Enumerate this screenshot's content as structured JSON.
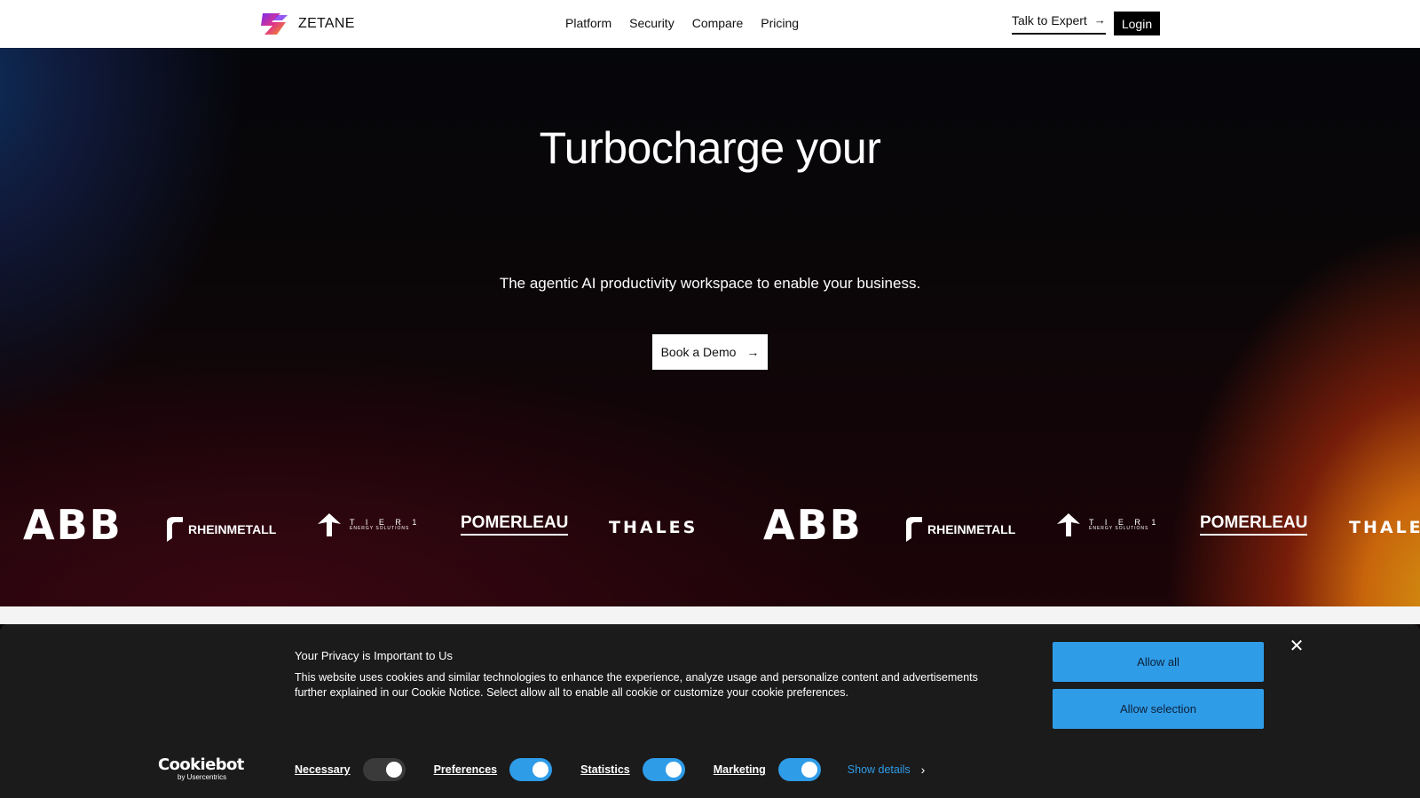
{
  "header": {
    "brand": "ZETANE",
    "nav": [
      "Platform",
      "Security",
      "Compare",
      "Pricing"
    ],
    "talk_label": "Talk to Expert",
    "talk_icon": "arrow-right-icon",
    "login_label": "Login"
  },
  "hero": {
    "title": "Turbocharge your",
    "subtitle": "The agentic AI productivity workspace to enable your business.",
    "cta_label": "Book a Demo",
    "cta_icon": "arrow-right-icon"
  },
  "logos": {
    "abb": "ABB",
    "rheinmetall": "RHEINMETALL",
    "tier1": "T I E R 1",
    "tier1_sub": "ENERGY SOLUTIONS",
    "pomerleau": "POMERLEAU",
    "thales": "THALES"
  },
  "cookie": {
    "title": "Your Privacy is Important to Us",
    "text": "This website uses cookies and similar technologies to enhance the experience, analyze usage and personalize content and advertisements further explained in our Cookie Notice. Select allow all to enable all cookie or customize your cookie preferences.",
    "allow_all": "Allow all",
    "allow_selection": "Allow selection",
    "close_icon": "close-icon",
    "cookiebot_logo": "Cookiebot",
    "cookiebot_sub": "by Usercentrics",
    "necessary": "Necessary",
    "preferences": "Preferences",
    "statistics": "Statistics",
    "marketing": "Marketing",
    "show_details": "Show details",
    "toggles": {
      "necessary": true,
      "preferences": true,
      "statistics": true,
      "marketing": true
    }
  },
  "colors": {
    "accent": "#2f9ce8",
    "hero_orange": "#d28e10",
    "hero_blue": "#0d2f5a"
  }
}
